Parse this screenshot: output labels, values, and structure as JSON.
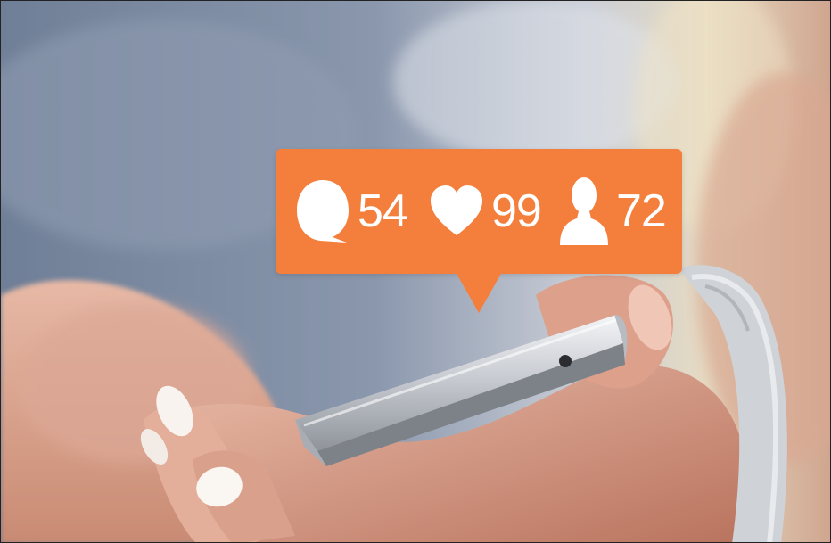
{
  "notification": {
    "accent_color": "#f47f3c",
    "items": [
      {
        "icon": "comment-bubble-icon",
        "count": "54"
      },
      {
        "icon": "heart-icon",
        "count": "99"
      },
      {
        "icon": "user-icon",
        "count": "72"
      }
    ]
  }
}
